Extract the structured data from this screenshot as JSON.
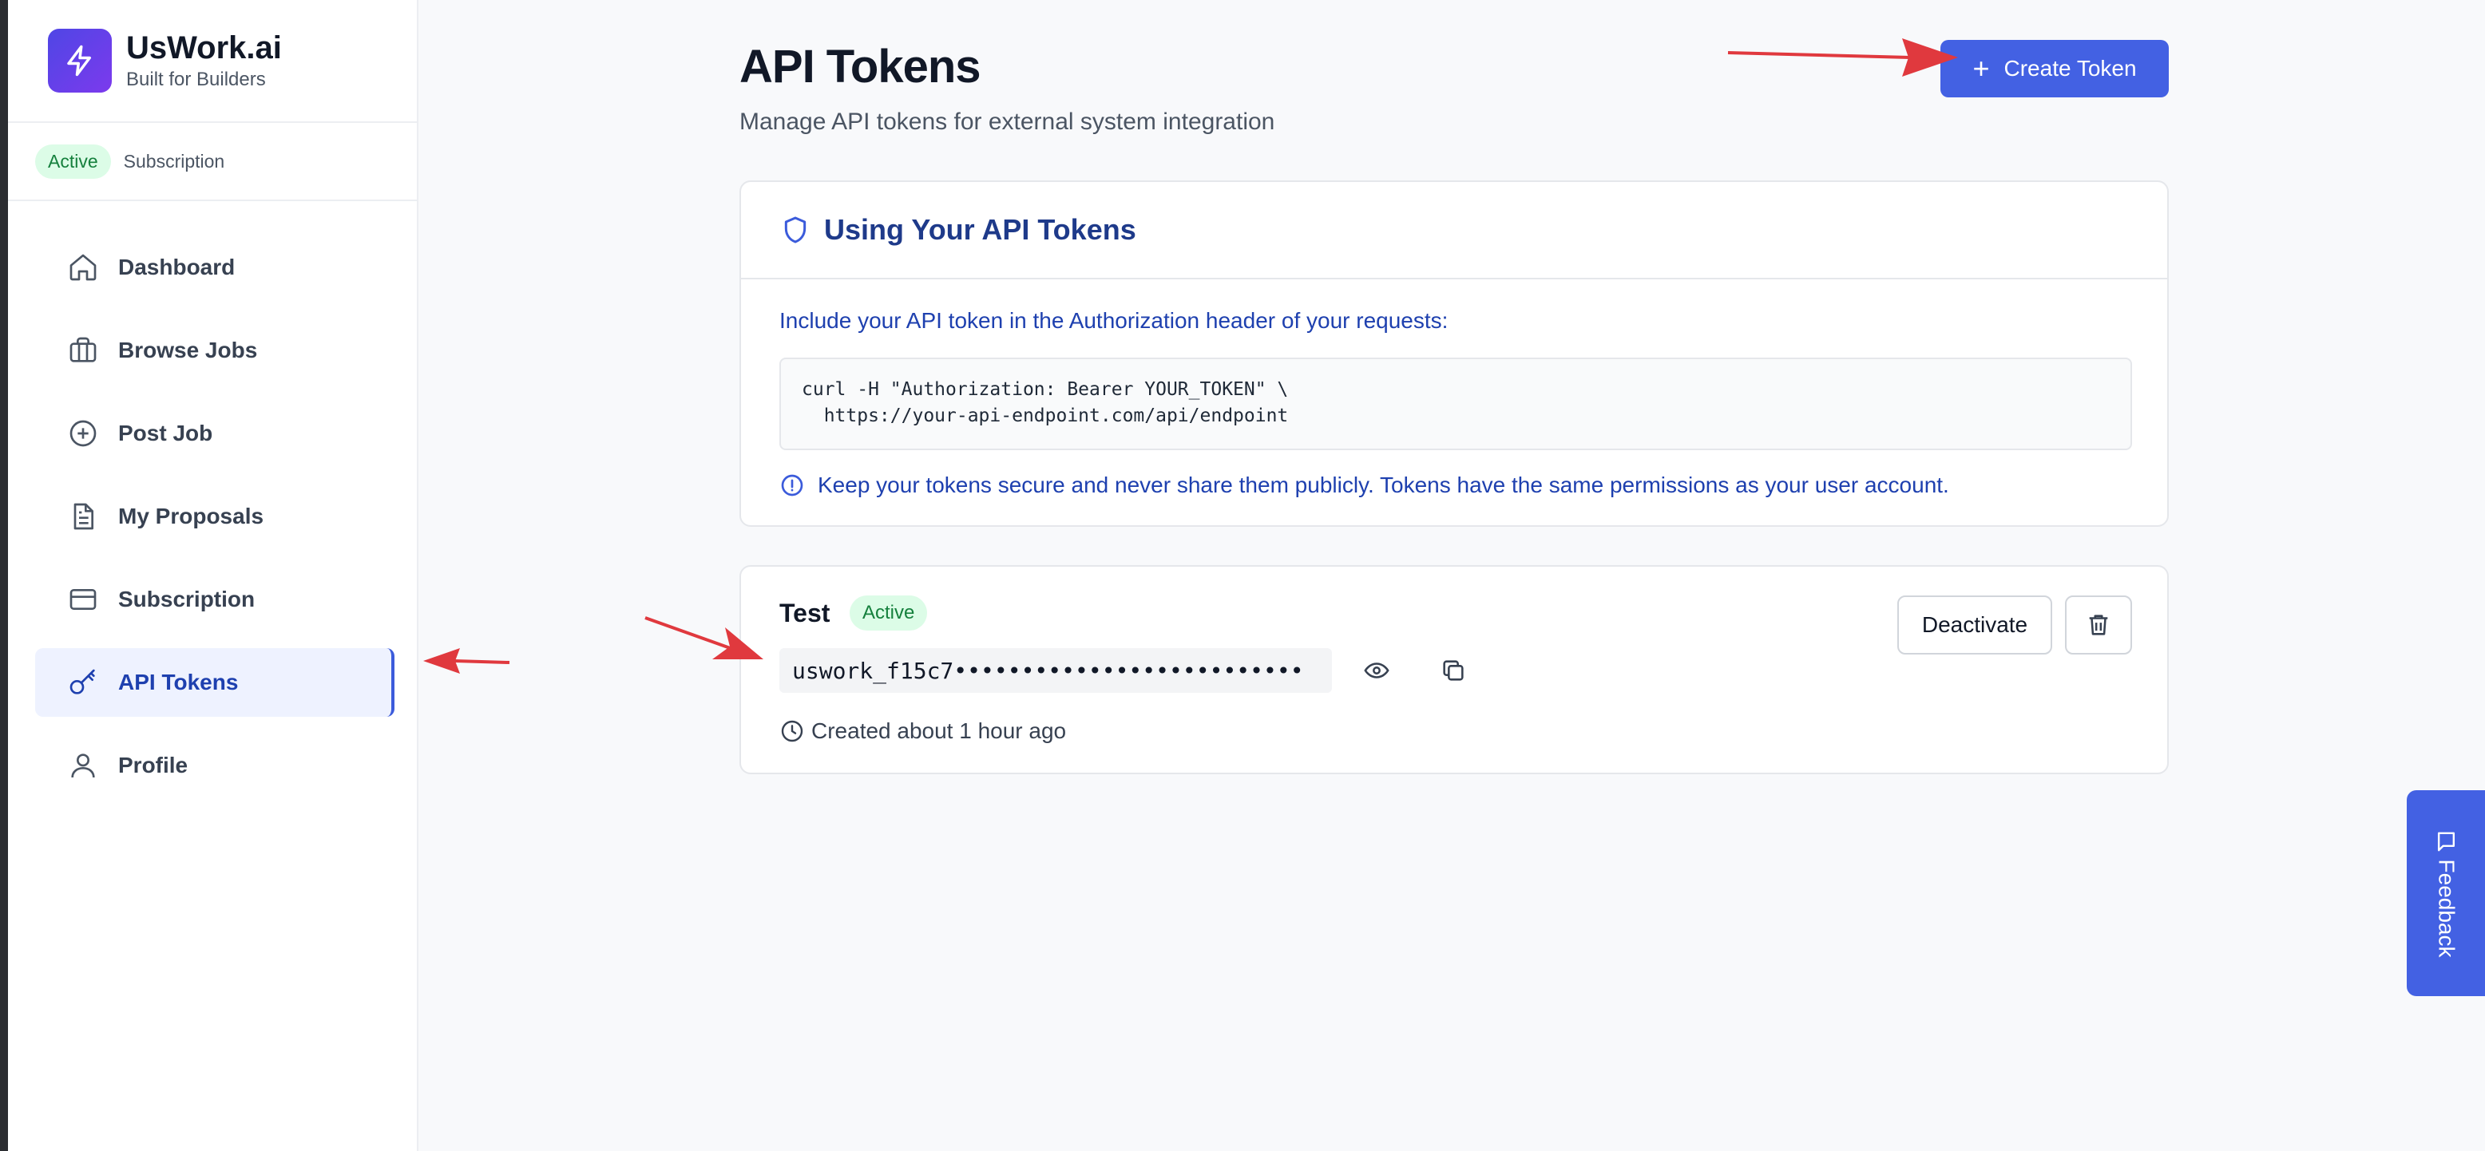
{
  "brand": {
    "name": "UsWork.ai",
    "tagline": "Built for Builders"
  },
  "subscription": {
    "status": "Active",
    "label": "Subscription"
  },
  "sidebar": {
    "items": [
      {
        "label": "Dashboard",
        "icon": "home-icon"
      },
      {
        "label": "Browse Jobs",
        "icon": "briefcase-icon"
      },
      {
        "label": "Post Job",
        "icon": "plus-circle-icon"
      },
      {
        "label": "My Proposals",
        "icon": "document-icon"
      },
      {
        "label": "Subscription",
        "icon": "credit-card-icon"
      },
      {
        "label": "API Tokens",
        "icon": "key-icon",
        "active": true
      },
      {
        "label": "Profile",
        "icon": "user-icon"
      }
    ]
  },
  "header": {
    "title": "API Tokens",
    "subtitle": "Manage API tokens for external system integration",
    "create_label": "Create Token"
  },
  "usage": {
    "title": "Using Your API Tokens",
    "description": "Include your API token in the Authorization header of your requests:",
    "code": "curl -H \"Authorization: Bearer YOUR_TOKEN\" \\\n  https://your-api-endpoint.com/api/endpoint",
    "warning": "Keep your tokens secure and never share them publicly. Tokens have the same permissions as your user account."
  },
  "tokens": [
    {
      "name": "Test",
      "status": "Active",
      "value": "uswork_f15c7••••••••••••••••••••••••••",
      "created": "Created about 1 hour ago",
      "deactivate_label": "Deactivate"
    }
  ],
  "feedback": {
    "label": "Feedback"
  },
  "colors": {
    "primary": "#4361e3",
    "active_badge_bg": "#dcfce7",
    "active_badge_text": "#15803d",
    "annotation_arrow": "#e0393e"
  }
}
